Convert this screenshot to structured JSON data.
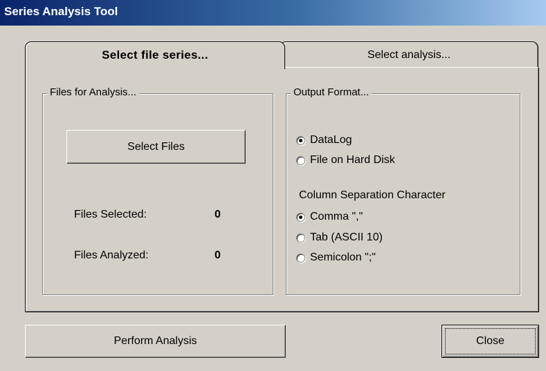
{
  "window": {
    "title": "Series Analysis Tool"
  },
  "tabs": [
    {
      "label": "Select file series...",
      "active": true
    },
    {
      "label": "Select analysis...",
      "active": false
    }
  ],
  "files_group": {
    "legend": "Files for Analysis...",
    "select_button": "Select Files",
    "selected_label": "Files Selected:",
    "selected_value": "0",
    "analyzed_label": "Files Analyzed:",
    "analyzed_value": "0"
  },
  "output_group": {
    "legend": "Output Format...",
    "formats": [
      {
        "label": "DataLog",
        "checked": true
      },
      {
        "label": "File on Hard Disk",
        "checked": false
      }
    ],
    "separator_title": "Column Separation Character",
    "separators": [
      {
        "label": "Comma \",\"",
        "checked": true
      },
      {
        "label": "Tab (ASCII 10)",
        "checked": false
      },
      {
        "label": "Semicolon \";\"",
        "checked": false
      }
    ]
  },
  "footer": {
    "perform_button": "Perform Analysis",
    "close_button": "Close"
  }
}
